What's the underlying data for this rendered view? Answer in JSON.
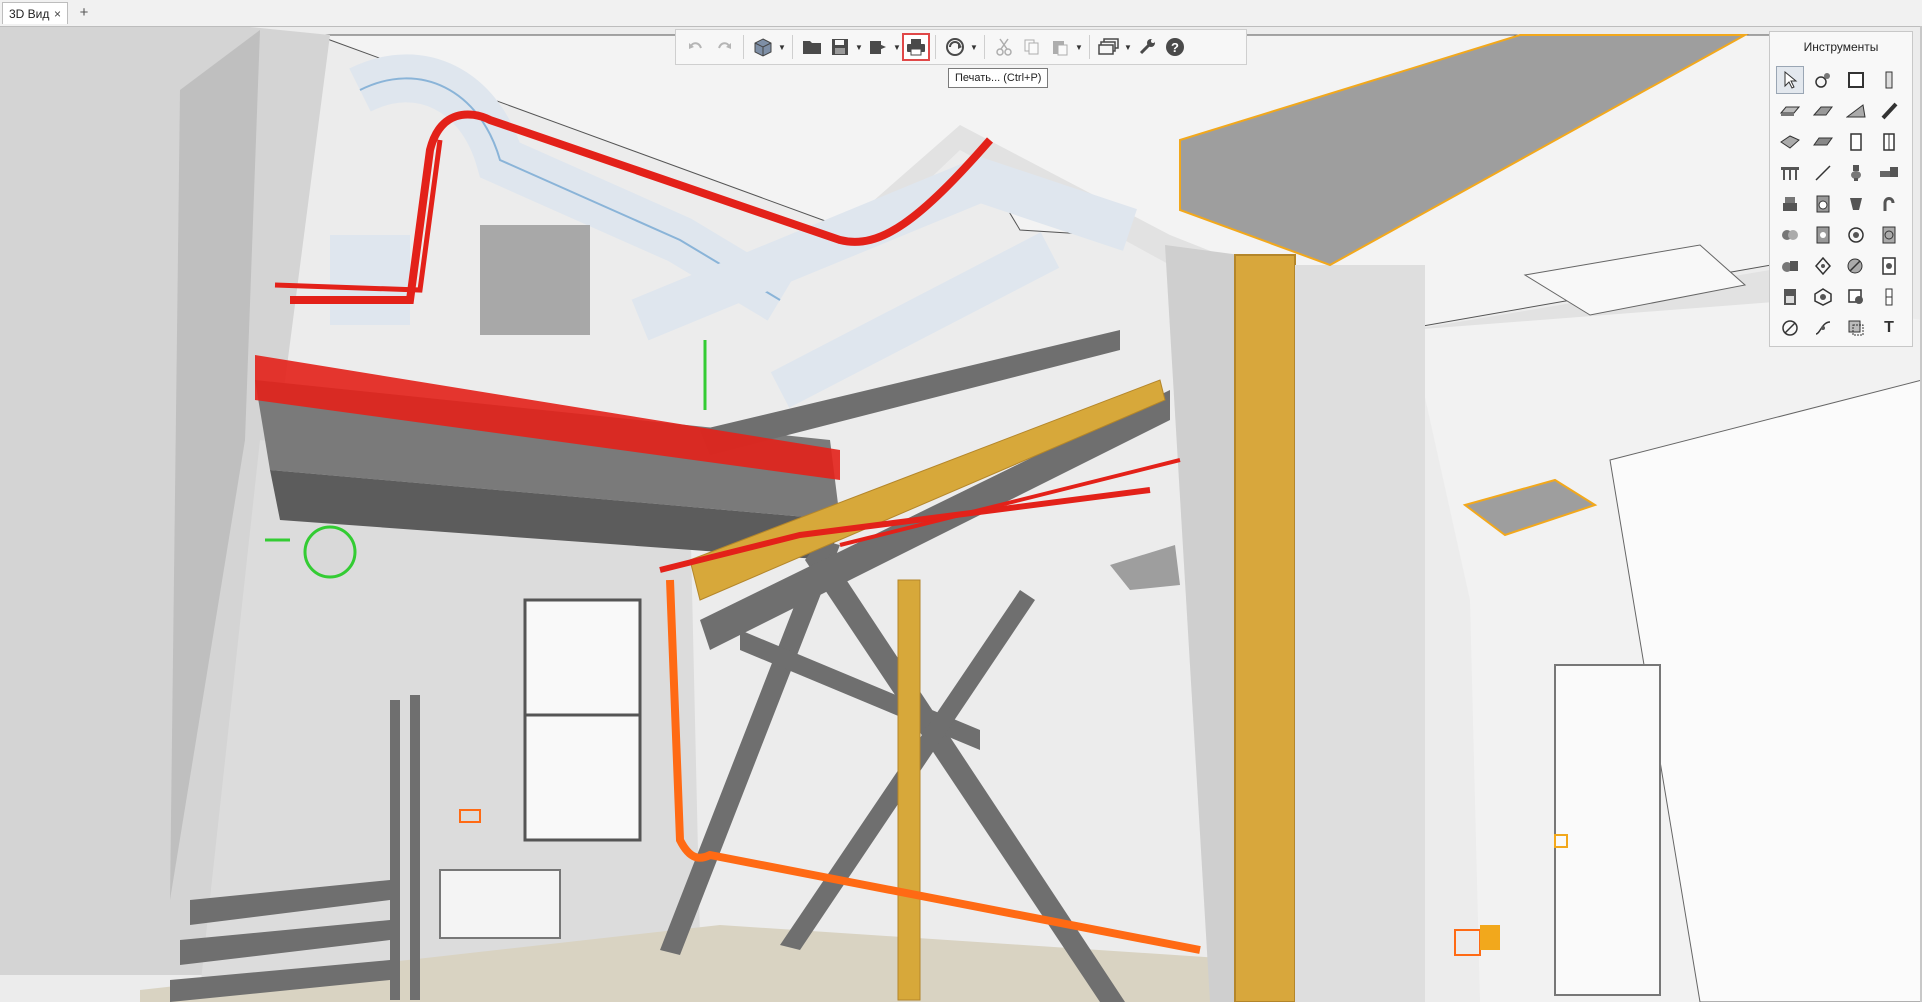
{
  "tabbar": {
    "tabs": [
      {
        "label": "3D Вид",
        "close": "×"
      }
    ],
    "add_label": "+"
  },
  "toolbar": {
    "buttons": [
      {
        "icon": "undo-icon",
        "enabled": false
      },
      {
        "icon": "redo-icon",
        "enabled": false
      },
      {
        "icon": "cube-icon",
        "enabled": true,
        "dropdown": true
      },
      {
        "icon": "folder-open-icon",
        "enabled": true
      },
      {
        "icon": "save-icon",
        "enabled": true,
        "dropdown": true
      },
      {
        "icon": "export-icon",
        "enabled": true,
        "dropdown": true
      },
      {
        "icon": "print-icon",
        "enabled": true,
        "active": true
      },
      {
        "icon": "sync-icon",
        "enabled": true,
        "dropdown": true
      },
      {
        "icon": "cut-icon",
        "enabled": false
      },
      {
        "icon": "copy-icon",
        "enabled": false
      },
      {
        "icon": "paste-icon",
        "enabled": false,
        "dropdown": true
      },
      {
        "icon": "layers-icon",
        "enabled": true,
        "dropdown": true
      },
      {
        "icon": "wrench-icon",
        "enabled": true
      },
      {
        "icon": "help-icon",
        "enabled": true
      }
    ],
    "tooltip": "Печать... (Ctrl+P)"
  },
  "tools_panel": {
    "title": "Инструменты",
    "tools": [
      "pointer-icon",
      "shape-tool-icon",
      "rectangle-tool-icon",
      "column-tool-icon",
      "slab-icon",
      "roof-icon",
      "stairs-icon",
      "beam-icon",
      "wall-icon",
      "curtain-icon",
      "door-icon",
      "window-icon",
      "railing-icon",
      "line-icon",
      "toilet-icon",
      "pipe-icon",
      "sink-icon",
      "washer-icon",
      "fitting-icon",
      "duct-icon",
      "valve-icon",
      "boiler-icon",
      "pump-icon",
      "fan-icon",
      "equipment-icon",
      "lamp-icon",
      "socket-icon",
      "switch-icon",
      "panel-icon",
      "sensor-icon",
      "outlet-icon",
      "cable-icon",
      "hatch-icon",
      "curve-icon",
      "fill-icon",
      "text-icon"
    ],
    "text_tool_label": "T",
    "selected_index": 0
  },
  "viewport": {
    "view": "3D",
    "colors": {
      "background": "#ececec",
      "steel": "#6f6f6f",
      "ducts": "#dfe6ee",
      "duct_edges": "#8ab4d8",
      "fire_pipes": "#e32119",
      "cable_tray": "#ff6a14",
      "yellow_beams": "#d7a83a",
      "selection_outline": "#f2a81c",
      "green_markers": "#33cc33"
    }
  }
}
